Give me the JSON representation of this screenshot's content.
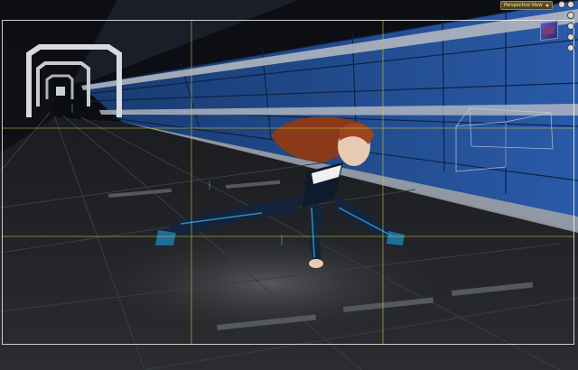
{
  "viewport": {
    "view_selector": {
      "label": "Perspective View"
    },
    "icons": {
      "dropdown_caret": "chevron-down-icon",
      "view_cube": "view-cube-icon",
      "orbit": "orbit-icon",
      "pan": "pan-icon",
      "zoom": "zoom-icon",
      "frame": "frame-icon"
    },
    "colors": {
      "wall_blue": "#1f4f96",
      "floor_dark": "#1a1c20",
      "guide_yellow": "#c8c840",
      "dropdown_gold": "#6b5a2a"
    }
  }
}
